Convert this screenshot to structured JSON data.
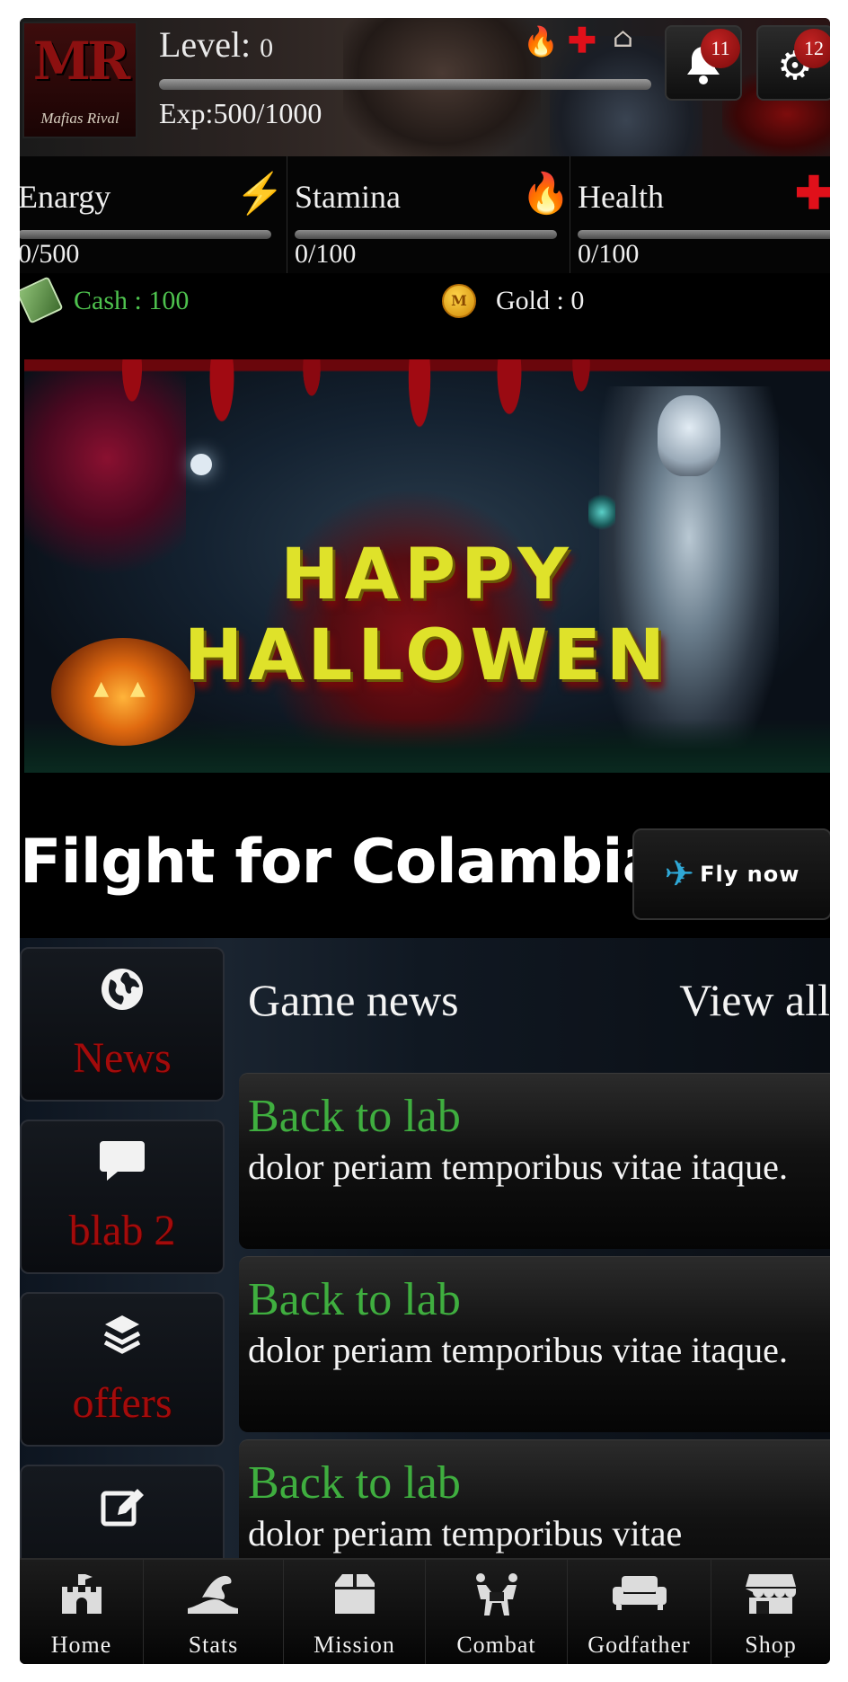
{
  "header": {
    "logo_big": "MR",
    "logo_small": "Mafias Rival",
    "level_label": "Level: ",
    "level_value": "0",
    "exp_text": "Exp:500/1000",
    "notifications_badge": "11",
    "settings_badge": "12"
  },
  "stats": {
    "energy": {
      "label": "Enargy",
      "value": "0/500"
    },
    "stamina": {
      "label": "Stamina",
      "value": "0/100"
    },
    "health": {
      "label": "Health",
      "value": "0/100"
    }
  },
  "currency": {
    "cash": "Cash : 100",
    "gold": "Gold : 0",
    "gold_icon_text": "M"
  },
  "banner": {
    "title": "HAPPY HALLOWEN"
  },
  "flight": {
    "title": "Filght for Colambia",
    "button_label": "Fly now"
  },
  "side_menu": {
    "items": [
      {
        "label": "News",
        "icon": "globe-icon"
      },
      {
        "label": "blab 2",
        "icon": "chat-icon"
      },
      {
        "label": "offers",
        "icon": "layers-icon"
      },
      {
        "label": "",
        "icon": "edit-icon"
      }
    ]
  },
  "news": {
    "title": "Game news",
    "view_all": "View all",
    "items": [
      {
        "title": "Back to lab",
        "body": "dolor periam temporibus vitae itaque."
      },
      {
        "title": "Back to lab",
        "body": "dolor periam temporibus vitae itaque."
      },
      {
        "title": "Back to lab",
        "body": "dolor periam temporibus vitae"
      }
    ]
  },
  "nav": {
    "items": [
      {
        "label": "Home",
        "icon": "castle-icon"
      },
      {
        "label": "Stats",
        "icon": "stats-icon"
      },
      {
        "label": "Mission",
        "icon": "box-icon"
      },
      {
        "label": "Combat",
        "icon": "combat-icon"
      },
      {
        "label": "Godfather",
        "icon": "sofa-icon"
      },
      {
        "label": "Shop",
        "icon": "store-icon"
      }
    ]
  },
  "colors": {
    "cash_green": "#4ec24e",
    "news_title_green": "#3fae3f",
    "menu_red": "#a30b0b",
    "banner_yellow": "#dfe22a"
  }
}
